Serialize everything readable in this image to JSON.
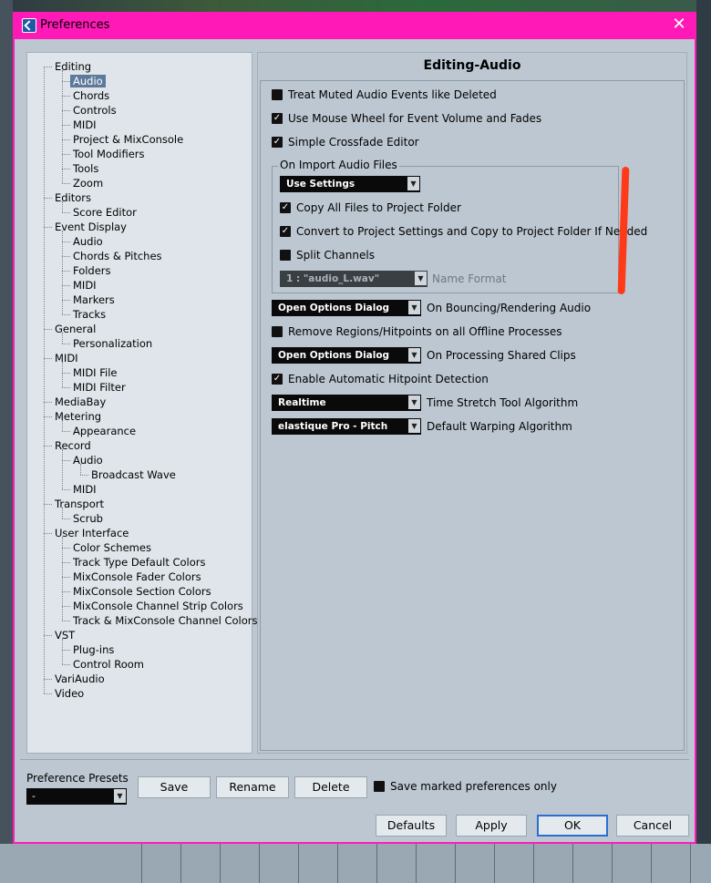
{
  "window": {
    "title": "Preferences",
    "close_glyph": "✕"
  },
  "tree": [
    {
      "label": "Editing",
      "level": 0
    },
    {
      "label": "Audio",
      "level": 1,
      "selected": true
    },
    {
      "label": "Chords",
      "level": 1
    },
    {
      "label": "Controls",
      "level": 1
    },
    {
      "label": "MIDI",
      "level": 1
    },
    {
      "label": "Project & MixConsole",
      "level": 1
    },
    {
      "label": "Tool Modifiers",
      "level": 1
    },
    {
      "label": "Tools",
      "level": 1
    },
    {
      "label": "Zoom",
      "level": 1
    },
    {
      "label": "Editors",
      "level": 0
    },
    {
      "label": "Score Editor",
      "level": 1
    },
    {
      "label": "Event Display",
      "level": 0
    },
    {
      "label": "Audio",
      "level": 1
    },
    {
      "label": "Chords & Pitches",
      "level": 1
    },
    {
      "label": "Folders",
      "level": 1
    },
    {
      "label": "MIDI",
      "level": 1
    },
    {
      "label": "Markers",
      "level": 1
    },
    {
      "label": "Tracks",
      "level": 1
    },
    {
      "label": "General",
      "level": 0
    },
    {
      "label": "Personalization",
      "level": 1
    },
    {
      "label": "MIDI",
      "level": 0
    },
    {
      "label": "MIDI File",
      "level": 1
    },
    {
      "label": "MIDI Filter",
      "level": 1
    },
    {
      "label": "MediaBay",
      "level": 0
    },
    {
      "label": "Metering",
      "level": 0
    },
    {
      "label": "Appearance",
      "level": 1
    },
    {
      "label": "Record",
      "level": 0
    },
    {
      "label": "Audio",
      "level": 1
    },
    {
      "label": "Broadcast Wave",
      "level": 2
    },
    {
      "label": "MIDI",
      "level": 1
    },
    {
      "label": "Transport",
      "level": 0
    },
    {
      "label": "Scrub",
      "level": 1
    },
    {
      "label": "User Interface",
      "level": 0
    },
    {
      "label": "Color Schemes",
      "level": 1
    },
    {
      "label": "Track Type Default Colors",
      "level": 1
    },
    {
      "label": "MixConsole Fader Colors",
      "level": 1
    },
    {
      "label": "MixConsole Section Colors",
      "level": 1
    },
    {
      "label": "MixConsole Channel Strip Colors",
      "level": 1
    },
    {
      "label": "Track & MixConsole Channel Colors",
      "level": 1
    },
    {
      "label": "VST",
      "level": 0
    },
    {
      "label": "Plug-ins",
      "level": 1
    },
    {
      "label": "Control Room",
      "level": 1
    },
    {
      "label": "VariAudio",
      "level": 0
    },
    {
      "label": "Video",
      "level": 0
    }
  ],
  "page": {
    "title": "Editing-Audio",
    "opt_treat_muted": {
      "label": "Treat Muted Audio Events like Deleted",
      "checked": false
    },
    "opt_mouse_wheel": {
      "label": "Use Mouse Wheel for Event Volume and Fades",
      "checked": true
    },
    "opt_crossfade": {
      "label": "Simple Crossfade Editor",
      "checked": true
    },
    "import_group": {
      "title": "On Import Audio Files",
      "mode_value": "Use Settings",
      "copy_files": {
        "label": "Copy All Files to Project Folder",
        "checked": true
      },
      "convert": {
        "label": "Convert to Project Settings and Copy to Project Folder If Needed",
        "checked": true
      },
      "split": {
        "label": "Split Channels",
        "checked": false
      },
      "name_format_value": "1 : \"audio_L.wav\"",
      "name_format_label": "Name Format"
    },
    "bounce_value": "Open Options Dialog",
    "bounce_label": "On Bouncing/Rendering Audio",
    "opt_remove_regions": {
      "label": "Remove Regions/Hitpoints on all Offline Processes",
      "checked": false
    },
    "shared_value": "Open Options Dialog",
    "shared_label": "On Processing Shared Clips",
    "opt_hitpoint": {
      "label": "Enable Automatic Hitpoint Detection",
      "checked": true
    },
    "timestretch_value": "Realtime",
    "timestretch_label": "Time Stretch Tool Algorithm",
    "warp_value": "elastique Pro - Pitch",
    "warp_label": "Default Warping Algorithm"
  },
  "bottom": {
    "presets_label": "Preference Presets",
    "preset_value": "-",
    "save": "Save",
    "rename": "Rename",
    "delete": "Delete",
    "save_marked_label": "Save marked preferences only",
    "defaults": "Defaults",
    "apply": "Apply",
    "ok": "OK",
    "cancel": "Cancel"
  },
  "colors": {
    "titlebar": "#ff1ab8",
    "selection": "#5e7a9a",
    "annotation": "#ff3a1a"
  }
}
